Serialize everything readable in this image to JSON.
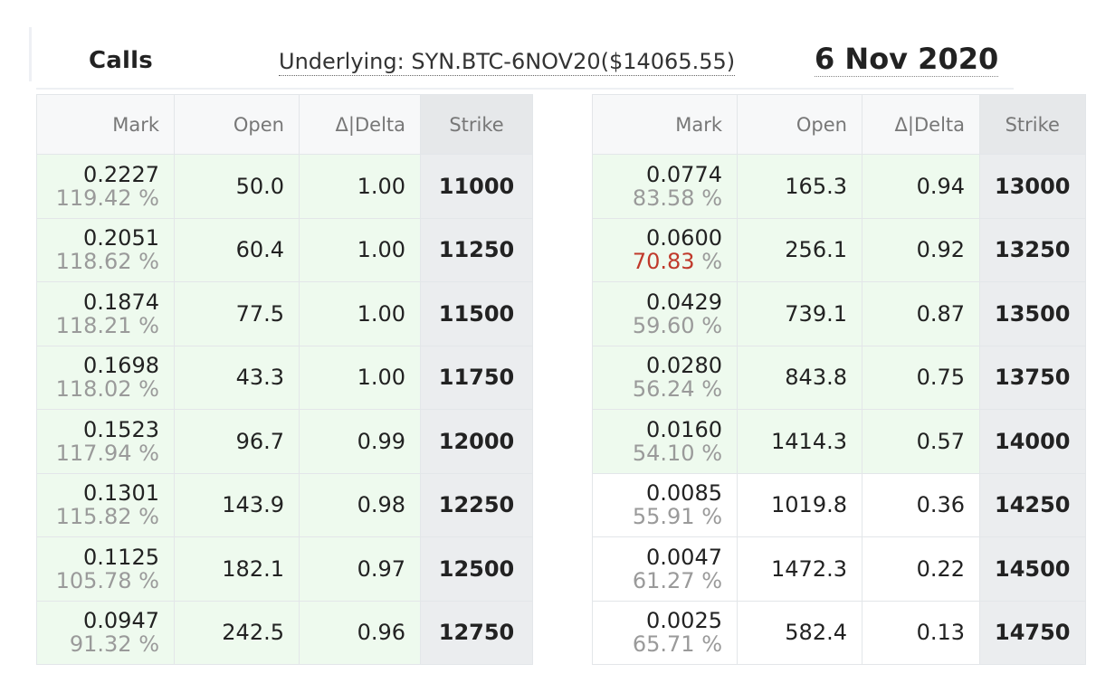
{
  "header": {
    "calls_label": "Calls",
    "underlying": "Underlying: SYN.BTC-6NOV20($14065.55)",
    "expiry": "6 Nov 2020"
  },
  "columns": {
    "mark": "Mark",
    "open": "Open",
    "delta": "Δ|Delta",
    "strike": "Strike"
  },
  "left_rows": [
    {
      "mark": "0.2227",
      "iv": "119.42 %",
      "open": "50.0",
      "delta": "1.00",
      "strike": "11000"
    },
    {
      "mark": "0.2051",
      "iv": "118.62 %",
      "open": "60.4",
      "delta": "1.00",
      "strike": "11250"
    },
    {
      "mark": "0.1874",
      "iv": "118.21 %",
      "open": "77.5",
      "delta": "1.00",
      "strike": "11500"
    },
    {
      "mark": "0.1698",
      "iv": "118.02 %",
      "open": "43.3",
      "delta": "1.00",
      "strike": "11750"
    },
    {
      "mark": "0.1523",
      "iv": "117.94 %",
      "open": "96.7",
      "delta": "0.99",
      "strike": "12000"
    },
    {
      "mark": "0.1301",
      "iv": "115.82 %",
      "open": "143.9",
      "delta": "0.98",
      "strike": "12250"
    },
    {
      "mark": "0.1125",
      "iv": "105.78 %",
      "open": "182.1",
      "delta": "0.97",
      "strike": "12500"
    },
    {
      "mark": "0.0947",
      "iv": "91.32 %",
      "open": "242.5",
      "delta": "0.96",
      "strike": "12750"
    }
  ],
  "right_rows": [
    {
      "mark": "0.0774",
      "iv": "83.58 %",
      "open": "165.3",
      "delta": "0.94",
      "strike": "13000",
      "in_the_money": true
    },
    {
      "mark": "0.0600",
      "iv": "70.83",
      "iv_suffix": " %",
      "iv_highlight": true,
      "open": "256.1",
      "delta": "0.92",
      "strike": "13250",
      "in_the_money": true
    },
    {
      "mark": "0.0429",
      "iv": "59.60 %",
      "open": "739.1",
      "delta": "0.87",
      "strike": "13500",
      "in_the_money": true
    },
    {
      "mark": "0.0280",
      "iv": "56.24 %",
      "open": "843.8",
      "delta": "0.75",
      "strike": "13750",
      "in_the_money": true
    },
    {
      "mark": "0.0160",
      "iv": "54.10 %",
      "open": "1414.3",
      "delta": "0.57",
      "strike": "14000",
      "in_the_money": true
    },
    {
      "mark": "0.0085",
      "iv": "55.91 %",
      "open": "1019.8",
      "delta": "0.36",
      "strike": "14250",
      "in_the_money": false
    },
    {
      "mark": "0.0047",
      "iv": "61.27 %",
      "open": "1472.3",
      "delta": "0.22",
      "strike": "14500",
      "in_the_money": false
    },
    {
      "mark": "0.0025",
      "iv": "65.71 %",
      "open": "582.4",
      "delta": "0.13",
      "strike": "14750",
      "in_the_money": false
    }
  ],
  "colors": {
    "itm_background": "#eefaee",
    "strike_background": "#ebedef",
    "iv_gray": "#9a9a9a",
    "iv_highlight_red": "#c0392b"
  }
}
